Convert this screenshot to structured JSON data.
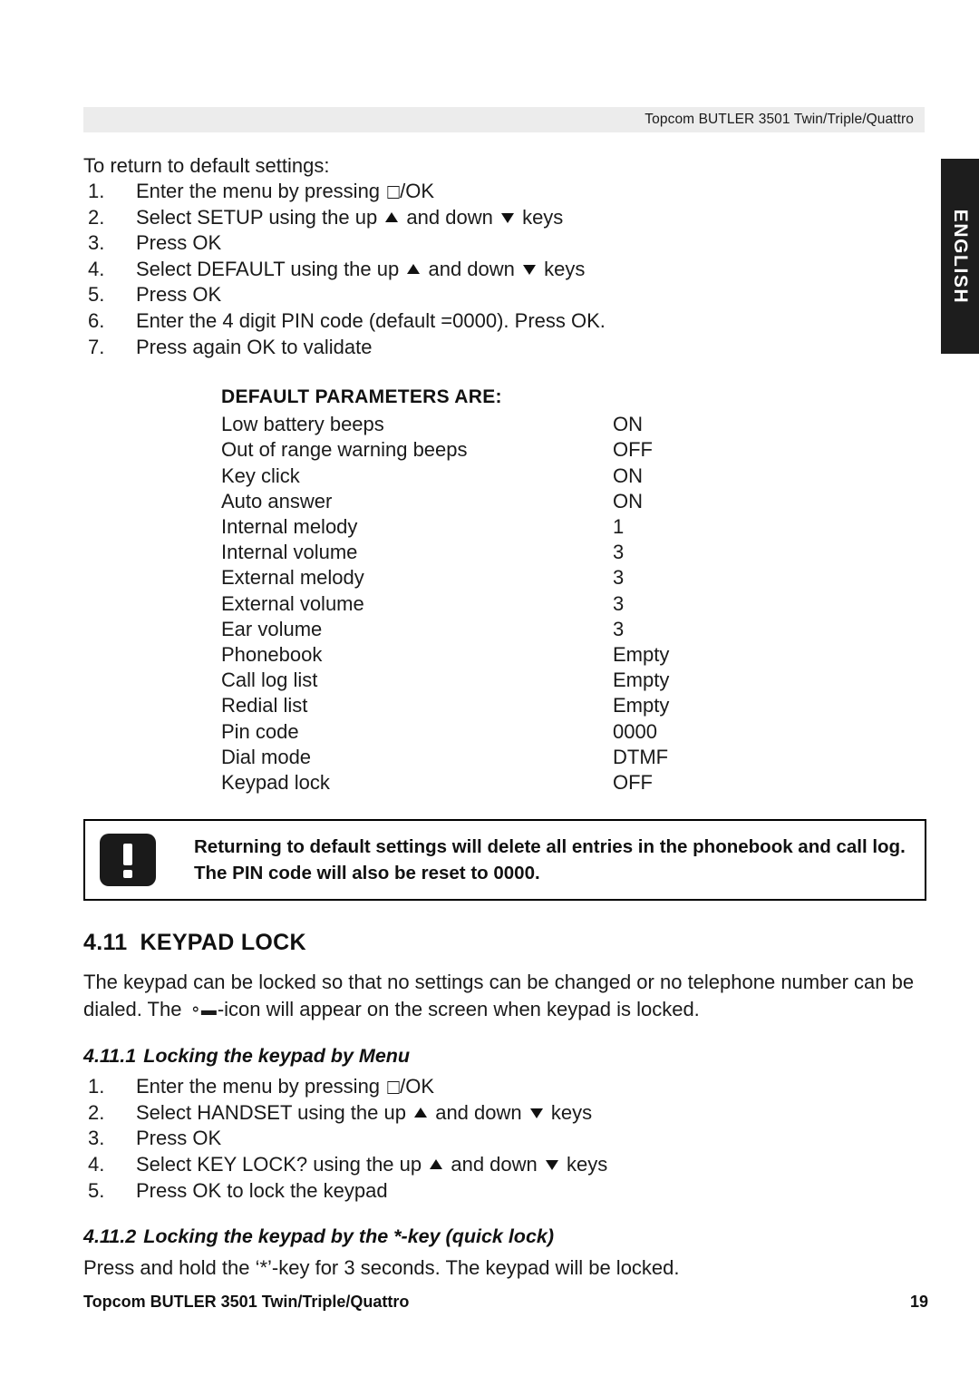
{
  "header": {
    "running_head": "Topcom BUTLER 3501 Twin/Triple/Quattro"
  },
  "language_tab": {
    "label": "ENGLISH"
  },
  "intro": {
    "lead": "To return to default settings:",
    "steps": [
      {
        "num": "1.",
        "pre": "Enter the menu by pressing ",
        "glyph": "menu-ok-icon",
        "post": "/OK"
      },
      {
        "num": "2.",
        "pre": "Select SETUP using the up ",
        "mid": " and down ",
        "post": " keys"
      },
      {
        "num": "3.",
        "pre": "Press OK"
      },
      {
        "num": "4.",
        "pre": "Select DEFAULT using the up ",
        "mid": " and down ",
        "post": " keys"
      },
      {
        "num": "5.",
        "pre": "Press OK"
      },
      {
        "num": "6.",
        "pre": "Enter the 4 digit PIN code (default =0000). Press OK."
      },
      {
        "num": "7.",
        "pre": "Press again OK to validate"
      }
    ]
  },
  "default_parameters": {
    "title": "DEFAULT PARAMETERS ARE:",
    "rows": [
      {
        "key": "Low battery beeps",
        "value": "ON"
      },
      {
        "key": "Out of range warning beeps",
        "value": "OFF"
      },
      {
        "key": "Key click",
        "value": "ON"
      },
      {
        "key": "Auto answer",
        "value": "ON"
      },
      {
        "key": "Internal melody",
        "value": "1"
      },
      {
        "key": "Internal volume",
        "value": "3"
      },
      {
        "key": "External melody",
        "value": "3"
      },
      {
        "key": "External volume",
        "value": "3"
      },
      {
        "key": "Ear volume",
        "value": "3"
      },
      {
        "key": "Phonebook",
        "value": "Empty"
      },
      {
        "key": "Call log list",
        "value": "Empty"
      },
      {
        "key": "Redial list",
        "value": "Empty"
      },
      {
        "key": "Pin code",
        "value": "0000"
      },
      {
        "key": "Dial mode",
        "value": "DTMF"
      },
      {
        "key": "Keypad lock",
        "value": "OFF"
      }
    ]
  },
  "warning": {
    "icon": "exclamation-icon",
    "text": "Returning to default settings will delete all entries in the phonebook and call log. The PIN code will also be reset to 0000."
  },
  "section": {
    "number": "4.11",
    "title": "KEYPAD LOCK",
    "paragraph_part1": "The keypad can be locked so that no settings can be changed or no telephone number can be dialed. The ",
    "paragraph_part2": "-icon will appear on the screen when keypad is locked."
  },
  "sub1": {
    "number": "4.11.1",
    "title": "Locking the keypad by Menu",
    "steps": [
      {
        "num": "1.",
        "pre": "Enter the menu by pressing ",
        "glyph": "menu-ok-icon",
        "post": "/OK"
      },
      {
        "num": "2.",
        "pre": "Select HANDSET using the up ",
        "mid": " and down ",
        "post": " keys"
      },
      {
        "num": "3.",
        "pre": "Press OK"
      },
      {
        "num": "4.",
        "pre": "Select KEY LOCK? using the up ",
        "mid": " and down ",
        "post": " keys"
      },
      {
        "num": "5.",
        "pre": "Press OK to lock the keypad"
      }
    ]
  },
  "sub2": {
    "number": "4.11.2",
    "title_plain": "Locking the keypad by the ",
    "title_star": "*-key",
    "title_italic_tail": " (quick lock)",
    "paragraph": "Press and hold the ‘*’-key for 3 seconds. The keypad will be locked."
  },
  "footer": {
    "left": "Topcom BUTLER 3501 Twin/Triple/Quattro",
    "page": "19"
  }
}
